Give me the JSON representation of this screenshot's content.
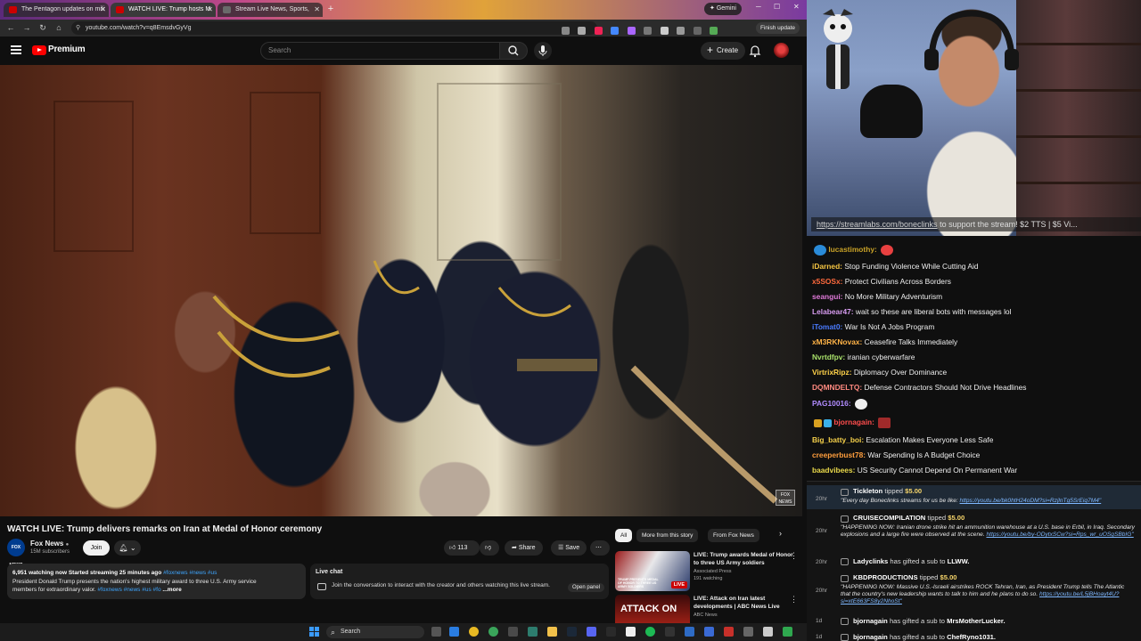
{
  "browser": {
    "tabs": [
      {
        "label": "The Pentagon updates on mili",
        "color": "#cc0000"
      },
      {
        "label": "WATCH LIVE: Trump hosts M",
        "color": "#cc0000"
      },
      {
        "label": "Stream Live News, Sports,",
        "color": "#6a6a6a"
      }
    ],
    "gemini_label": "Gemini",
    "url": "youtube.com/watch?v=q8EmsdvGyVg",
    "finish_update": "Finish update"
  },
  "youtube": {
    "brand": "Premium",
    "search_placeholder": "Search",
    "create_label": "Create"
  },
  "video": {
    "title": "WATCH LIVE: Trump delivers remarks on Iran at Medal of Honor ceremony",
    "channel": "Fox News",
    "channel_logo_text": "FOX NEWS",
    "subscribers": "15M subscribers",
    "join_label": "Join",
    "likes": "113",
    "share_label": "Share",
    "save_label": "Save",
    "watch_stats": "6,951 watching now  Started streaming 25 minutes ago",
    "stat_tags": "#foxnews #news #us",
    "description_line1": "President Donald Trump presents the nation's highest military award to three U.S. Army service",
    "description_line2": "members for extraordinary valor.",
    "desc_tags": "#foxnews #news #us #fo",
    "more_label": "...more",
    "live_chat_title": "Live chat",
    "live_chat_body": "Join the conversation to interact with the creator and others watching this live stream.",
    "open_panel_label": "Open panel"
  },
  "recommend": {
    "chips": [
      "All",
      "More from this story",
      "From Fox News"
    ],
    "items": [
      {
        "title": "LIVE: Trump awards Medal of Honor to three US Army soldiers",
        "channel": "Associated Press",
        "views": "191 watching",
        "badge": "LIVE",
        "thumb_text": "TRUMP PRESENTS MEDAL OF HONOR TO THREE US ARMY SOLDIERS"
      },
      {
        "title": "LIVE: Attack on Iran latest developments | ABC News Live",
        "channel": "ABC News",
        "views": "",
        "badge": "",
        "thumb_text": "ATTACK ON"
      }
    ]
  },
  "taskbar": {
    "search_label": "Search"
  },
  "stream_overlay": {
    "link": "https://streamlabs.com/boneclinks",
    "text": " to support the stream! $2 TTS | $5 Vi..."
  },
  "chat": [
    {
      "user": "lucastimothy:",
      "color": "#c9a227",
      "message": ""
    },
    {
      "user": "iDarned:",
      "color": "#f5c542",
      "message": "Stop Funding Violence While Cutting Aid"
    },
    {
      "user": "x5SOSx:",
      "color": "#ff6a3d",
      "message": "Protect Civilians Across Borders"
    },
    {
      "user": "seangui:",
      "color": "#e07ad9",
      "message": "No More Military Adventurism"
    },
    {
      "user": "Lelabear47:",
      "color": "#d79cf0",
      "message": "wait so these are liberal bots with messages lol"
    },
    {
      "user": "iTomat0:",
      "color": "#4a7bff",
      "message": "War Is Not A Jobs Program"
    },
    {
      "user": "xM3RKNovax:",
      "color": "#ffb347",
      "message": "Ceasefire Talks Immediately"
    },
    {
      "user": "Nvrtdfpv:",
      "color": "#a8e06a",
      "message": "iranian cyberwarfare"
    },
    {
      "user": "VirtrixRipz:",
      "color": "#ffd24a",
      "message": "Diplomacy Over Dominance"
    },
    {
      "user": "DQMNDELTQ:",
      "color": "#ff8a80",
      "message": "Defense Contractors Should Not Drive Headlines"
    },
    {
      "user": "PAG10016:",
      "color": "#b18cff",
      "message": ""
    },
    {
      "user": "bjornagain:",
      "color": "#ff4d4d",
      "message": ""
    },
    {
      "user": "Big_batty_boi:",
      "color": "#f5d04a",
      "message": "Escalation Makes Everyone Less Safe"
    },
    {
      "user": "creeperbust78:",
      "color": "#ff9e3d",
      "message": "War Spending Is A Budget Choice"
    },
    {
      "user": "baadvibees:",
      "color": "#e8d84a",
      "message": "US Security Cannot Depend On Permanent War"
    }
  ],
  "events": [
    {
      "age": "20hr",
      "user": "Tickleton",
      "action": "tipped",
      "amount": "$5.00",
      "message": "\"Every day Boneclinks streams for us be like: ",
      "link": "https://youtu.be/bk0htH24oDM?si=RzjlnTg5SrEiq7M4\""
    },
    {
      "age": "20hr",
      "user": "CRUISECOMPILATION",
      "action": "tipped",
      "amount": "$5.00",
      "message": "\"HAPPENING NOW: Iranian drone strike hit an ammunition warehouse at a U.S. base in Erbil, in Iraq. Secondary explosions and a large fire were observed at the scene. ",
      "link": "https://youtu.be/by-ODytxSCw?si=Rps_wr_uOSgSBbIG\""
    },
    {
      "age": "20hr",
      "user": "Ladyclinks",
      "action": "has gifted a sub to",
      "amount": "",
      "target": "LLWW.",
      "message": "",
      "link": ""
    },
    {
      "age": "20hr",
      "user": "KBDPRODUCTIONS",
      "action": "tipped",
      "amount": "$5.00",
      "message": "\"HAPPENING NOW: Massive U.S.-Israeli airstrikes ROCK Tehran, Iran, as President Trump tells The Atlantic that the country's new leadership wants to talk to him and he plans to do so. ",
      "link": "https://youtu.be/L5jBHoayt4U?si=xtE663FS8y2NhoSt\""
    },
    {
      "age": "1d",
      "user": "bjornagain",
      "action": "has gifted a sub to",
      "amount": "",
      "target": "MrsMotherLucker.",
      "message": "",
      "link": ""
    },
    {
      "age": "1d",
      "user": "bjornagain",
      "action": "has gifted a sub to",
      "amount": "",
      "target": "ChefRyno1031.",
      "message": "",
      "link": ""
    }
  ],
  "colors": {
    "yt_red": "#ff0000",
    "link_blue": "#3ea6ff",
    "tip_gold": "#f5d46a",
    "highlight": "#1f2a36"
  }
}
